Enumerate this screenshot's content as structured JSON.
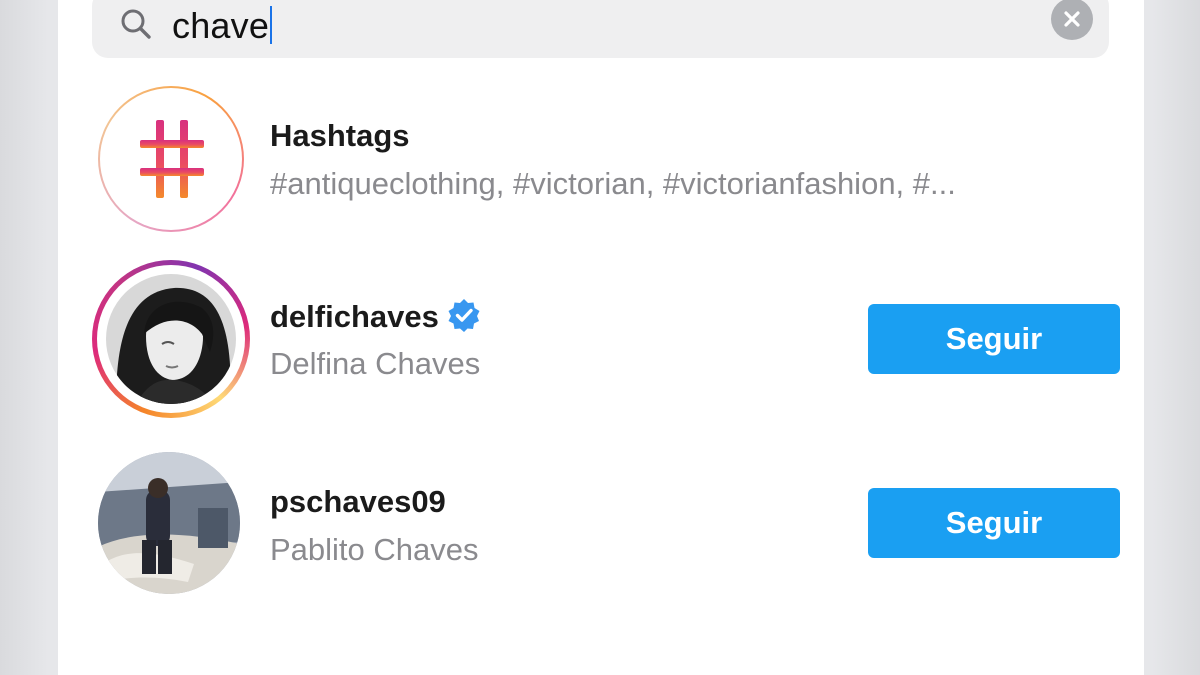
{
  "search": {
    "query": "chave",
    "search_icon": "search-icon",
    "clear_icon": "clear-icon"
  },
  "results": {
    "hashtags": {
      "title": "Hashtags",
      "subtitle": "#antiqueclothing, #victorian, #victorianfashion, #...",
      "icon": "hashtag-icon"
    },
    "users": [
      {
        "username": "delfichaves",
        "full_name": "Delfina Chaves",
        "verified": true,
        "has_story_ring": true,
        "follow_label": "Seguir"
      },
      {
        "username": "pschaves09",
        "full_name": "Pablito Chaves",
        "verified": false,
        "has_story_ring": false,
        "follow_label": "Seguir"
      }
    ]
  },
  "colors": {
    "accent": "#1a9ff2",
    "verified": "#3897f0",
    "secondary_text": "#8a8a8e"
  }
}
